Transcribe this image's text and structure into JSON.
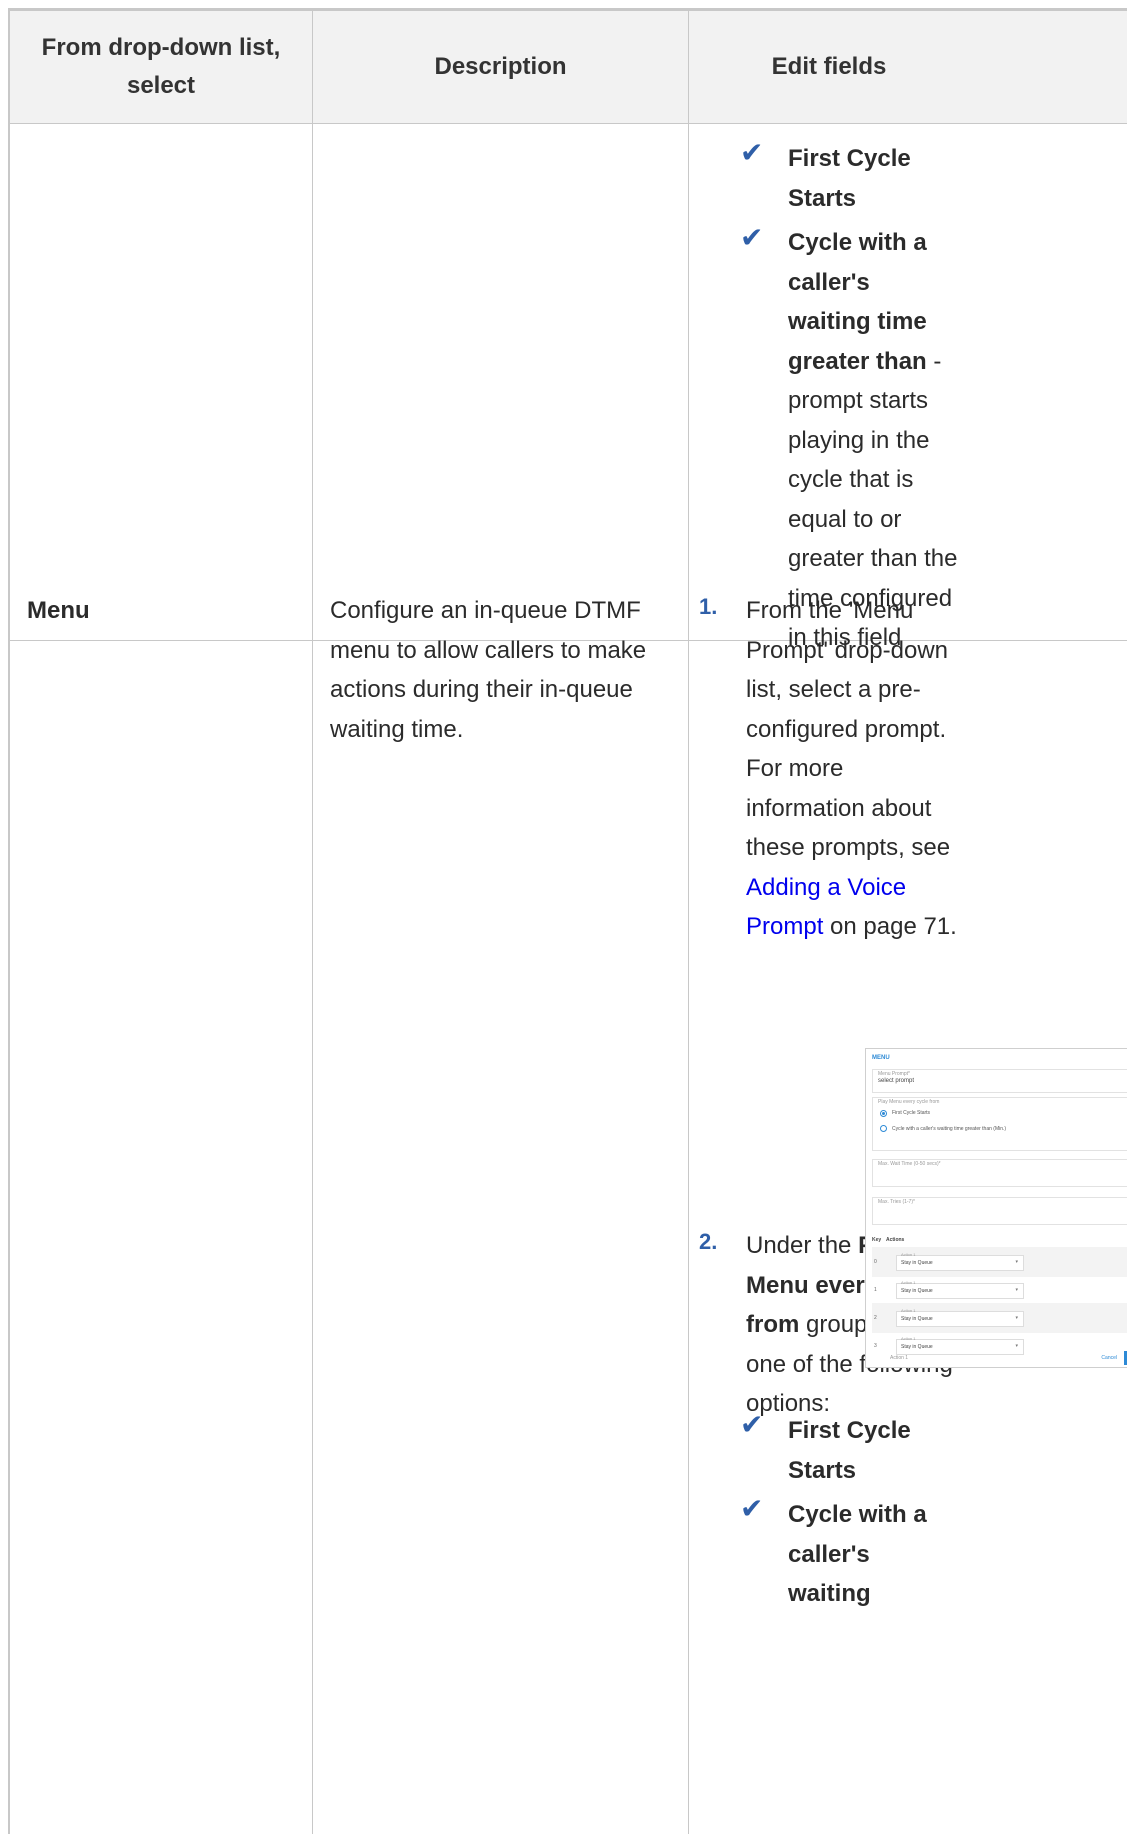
{
  "table": {
    "headers": [
      "From drop-down list, select",
      "Description",
      "Edit fields"
    ],
    "row1": {
      "bullets": [
        {
          "bold": "First Cycle Starts",
          "rest": ""
        },
        {
          "bold": "Cycle with a caller's waiting time greater than",
          "rest": " - prompt starts playing in the cycle that is equal to or greater than the time configured in this field"
        }
      ]
    },
    "row2": {
      "select": "Menu",
      "description": "Configure an in-queue DTMF menu to allow callers to make actions during their in-queue waiting time.",
      "step1_number": "1.",
      "step1_text_before": "From the 'Menu Prompt' drop-down list, select a pre-configured prompt. For more information about these prompts, see",
      "step1_link": "Adding a Voice Prompt",
      "step1_text_after": "on page 71.",
      "step2_number": "2.",
      "step2_parts": [
        "Under the",
        "Play Menu every cycle from",
        "group, select one of the following options:"
      ],
      "bullets": [
        "First Cycle Starts",
        "Cycle with a caller's waiting"
      ]
    }
  },
  "screenshot": {
    "title": "MENU",
    "menu_prompt_label": "Menu Prompt*",
    "menu_prompt_value": "select prompt",
    "play_every_label": "Play Menu every cycle from",
    "radio_1": "First Cycle Starts",
    "radio_2": "Cycle with a caller's waiting time greater than (Min.)",
    "max_wait_label": "Max. Wait Time (0-50 secs)*",
    "max_tries_label": "Max. Tries (1-7)*",
    "col_key": "Key",
    "col_actions": "Actions",
    "rows": [
      {
        "key": "0",
        "label": "Action 1",
        "value": "Stay in Queue"
      },
      {
        "key": "1",
        "label": "Action 1",
        "value": "Stay in Queue"
      },
      {
        "key": "2",
        "label": "Action 1",
        "value": "Stay in Queue"
      },
      {
        "key": "3",
        "label": "Action 1",
        "value": "Stay in Queue"
      }
    ],
    "partial_row_label": "Action 1",
    "cancel": "Cancel",
    "accent_color": "#2d8ad6"
  },
  "colors": {
    "border": "#c8c8c8",
    "header_bg": "#f2f2f2",
    "check_color": "#2f5fa8",
    "link_color": "#0000ee"
  }
}
